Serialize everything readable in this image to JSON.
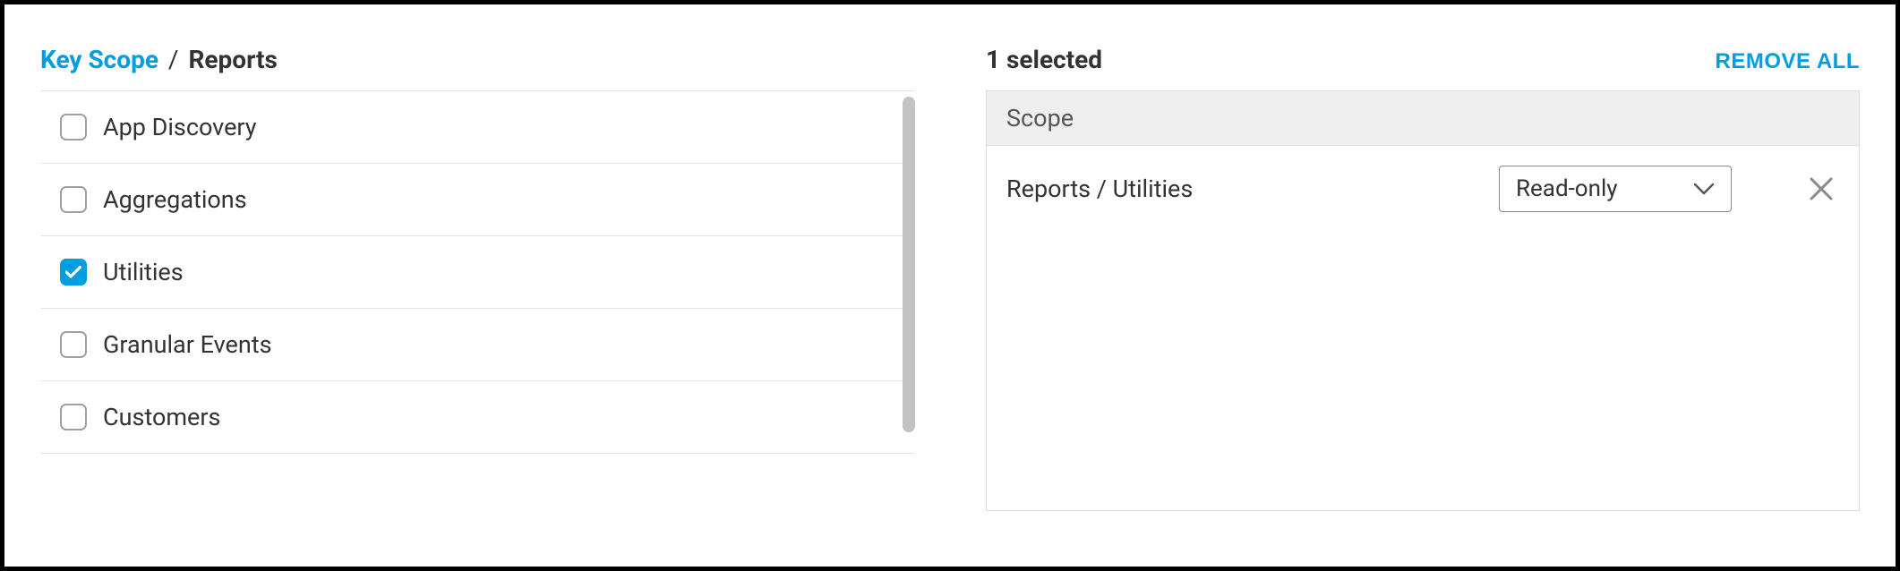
{
  "breadcrumb": {
    "root": "Key Scope",
    "sep": "/",
    "current": "Reports"
  },
  "scopes": [
    {
      "label": "App Discovery",
      "checked": false
    },
    {
      "label": "Aggregations",
      "checked": false
    },
    {
      "label": "Utilities",
      "checked": true
    },
    {
      "label": "Granular Events",
      "checked": false
    },
    {
      "label": "Customers",
      "checked": false
    }
  ],
  "selected": {
    "count_label": "1 selected",
    "remove_all_label": "REMOVE ALL",
    "header": "Scope",
    "rows": [
      {
        "path": "Reports / Utilities",
        "permission": "Read-only"
      }
    ]
  }
}
